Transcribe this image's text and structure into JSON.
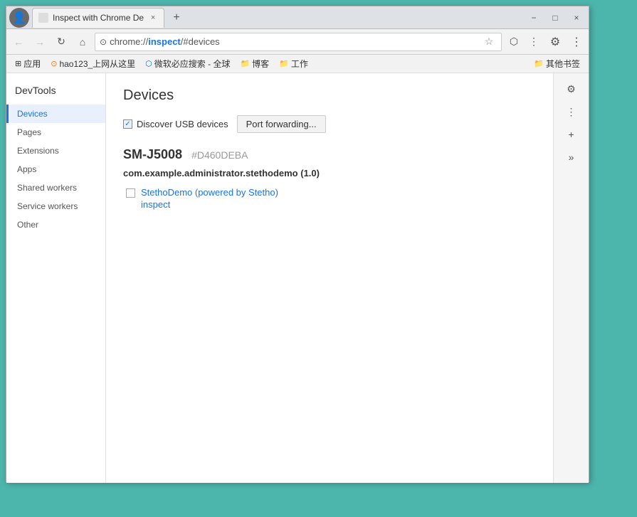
{
  "window": {
    "title": "Inspect with Chrome De",
    "tab_label": "Inspect with Chrome De",
    "close_label": "×",
    "minimize_label": "−",
    "maximize_label": "□"
  },
  "toolbar": {
    "address": "chrome://inspect/#devices",
    "address_scheme": "chrome://",
    "address_host": "inspect",
    "address_path": "/#devices",
    "back_title": "Back",
    "forward_title": "Forward",
    "reload_title": "Reload",
    "home_title": "Home"
  },
  "bookmarks": [
    {
      "label": "应用",
      "icon": "⊞"
    },
    {
      "label": "hao123_上网从这里",
      "icon": "🔖"
    },
    {
      "label": "微软必应搜索 - 全球",
      "icon": "🔖"
    },
    {
      "label": "博客",
      "icon": "📁"
    },
    {
      "label": "工作",
      "icon": "📁"
    },
    {
      "label": "其他书签",
      "icon": "📁"
    }
  ],
  "sidebar": {
    "title": "DevTools",
    "items": [
      {
        "id": "devices",
        "label": "Devices",
        "active": true
      },
      {
        "id": "pages",
        "label": "Pages",
        "active": false
      },
      {
        "id": "extensions",
        "label": "Extensions",
        "active": false
      },
      {
        "id": "apps",
        "label": "Apps",
        "active": false
      },
      {
        "id": "shared-workers",
        "label": "Shared workers",
        "active": false
      },
      {
        "id": "service-workers",
        "label": "Service workers",
        "active": false
      },
      {
        "id": "other",
        "label": "Other",
        "active": false
      }
    ]
  },
  "page": {
    "title": "Devices",
    "discover_usb_label": "Discover USB devices",
    "port_forwarding_label": "Port forwarding...",
    "device": {
      "name": "SM-J5008",
      "id": "#D460DEBA",
      "app": "com.example.administrator.stethodemo (1.0)",
      "webview_title": "StethoDemo (powered by Stetho)",
      "inspect_label": "inspect"
    }
  },
  "right_panel": {
    "settings_label": "⚙",
    "more_label": "⋮",
    "add_label": "+",
    "overflow_label": "»"
  }
}
